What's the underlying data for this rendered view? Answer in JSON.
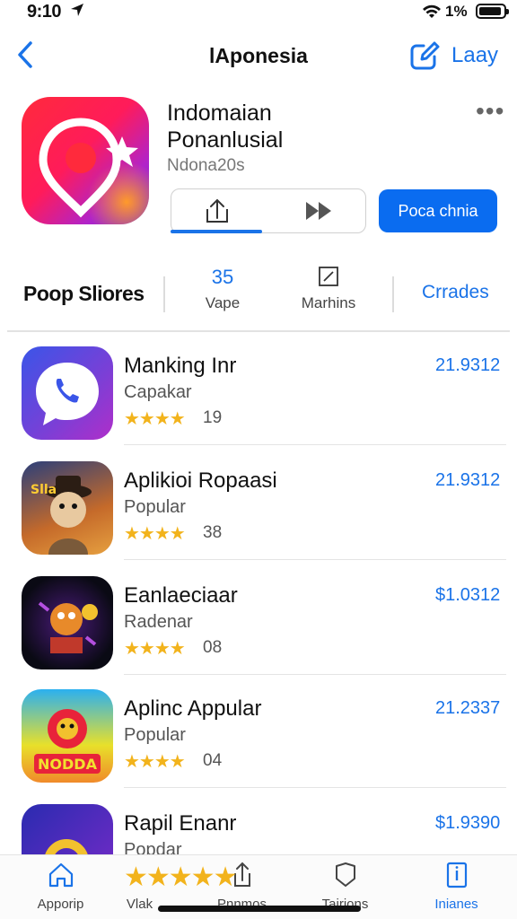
{
  "status": {
    "time": "9:10",
    "battery": "1%"
  },
  "nav": {
    "title": "lAponesia",
    "right": "Laay"
  },
  "hero": {
    "title_line1": "Indomaian",
    "title_line2": "Ponanlusial",
    "developer": "Ndona20s",
    "cta": "Poca chnia",
    "more": "•••"
  },
  "stats": {
    "label": "Poop Sliores",
    "count": "35",
    "count_label": "Vape",
    "mid_label": "Marhins",
    "right": "Crrades"
  },
  "list": [
    {
      "title": "Manking Inr",
      "subtitle": "Capakar",
      "stars": "★★★★",
      "count": "19",
      "price": "21.9312",
      "accent": "#5b3fd6"
    },
    {
      "title": "Aplikioi Ropaasi",
      "subtitle": "Popular",
      "stars": "★★★★",
      "count": "38",
      "price": "21.9312",
      "accent": "#d9822b"
    },
    {
      "title": "Eanlaeciaar",
      "subtitle": "Radenar",
      "stars": "★★★★",
      "count": "08",
      "price": "$1.0312",
      "accent": "#6a2bb0"
    },
    {
      "title": "Aplinc Appular",
      "subtitle": "Popular",
      "stars": "★★★★",
      "count": "04",
      "price": "21.2337",
      "accent": "#ff6a2a"
    },
    {
      "title": "Rapil Enanr",
      "subtitle": "Popdar",
      "stars": "",
      "count": "",
      "price": "$1.9390",
      "accent": "#3a2bb0"
    }
  ],
  "tabbar": {
    "items": [
      {
        "label": "Apporip",
        "icon": "home-icon"
      },
      {
        "label": "Vlak",
        "icon": "star-icon"
      },
      {
        "label": "Pnnmos",
        "icon": "share-icon"
      },
      {
        "label": "Tairions",
        "icon": "bookmark-icon"
      },
      {
        "label": "Inianes",
        "icon": "info-icon"
      }
    ],
    "rating_stars": "★★★★★"
  },
  "colors": {
    "accent": "#1a73e8",
    "cta": "#0a6cf0",
    "star": "#f2b31c"
  }
}
